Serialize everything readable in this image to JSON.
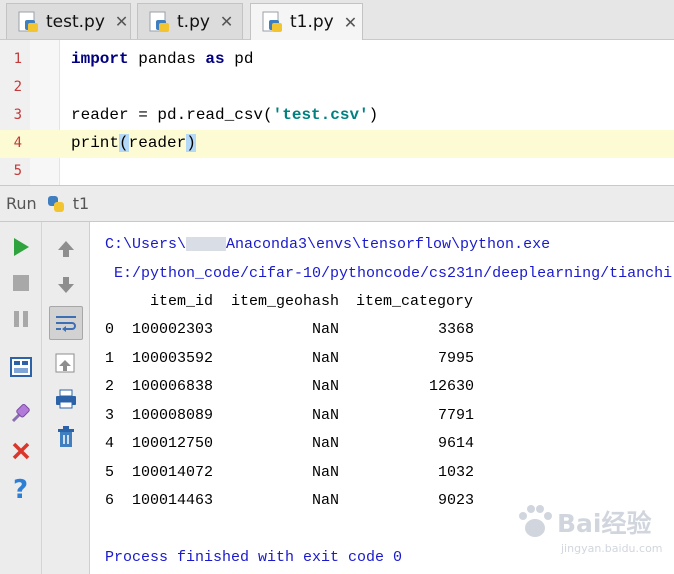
{
  "tabs": [
    {
      "label": "test.py",
      "active": false
    },
    {
      "label": "t.py",
      "active": false
    },
    {
      "label": "t1.py",
      "active": true
    }
  ],
  "tab_close_glyph": "✕",
  "editor": {
    "lines": [
      {
        "num": "1",
        "kw1": "import",
        "t1": " pandas ",
        "kw2": "as",
        "t2": " pd"
      },
      {
        "num": "2"
      },
      {
        "num": "3",
        "pre": "reader = pd.read_csv(",
        "str": "'test.csv'",
        "post": ")"
      },
      {
        "num": "4",
        "fn": "print",
        "open": "(",
        "arg": "reader",
        "close": ")"
      },
      {
        "num": "5"
      }
    ]
  },
  "run_panel": {
    "label": "Run",
    "config": "t1"
  },
  "console": {
    "path_prefix": "C:\\Users\\",
    "path_suffix": "Anaconda3\\envs\\tensorflow\\python.exe",
    "script_path": " E:/python_code/cifar-10/pythoncode/cs231n/deeplearning/tianchi",
    "table": {
      "headers": [
        "item_id",
        "item_geohash",
        "item_category"
      ],
      "rows": [
        [
          "0",
          "100002303",
          "NaN",
          "3368"
        ],
        [
          "1",
          "100003592",
          "NaN",
          "7995"
        ],
        [
          "2",
          "100006838",
          "NaN",
          "12630"
        ],
        [
          "3",
          "100008089",
          "NaN",
          "7791"
        ],
        [
          "4",
          "100012750",
          "NaN",
          "9614"
        ],
        [
          "5",
          "100014072",
          "NaN",
          "1032"
        ],
        [
          "6",
          "100014463",
          "NaN",
          "9023"
        ]
      ]
    },
    "exit_message": "Process finished with exit code 0"
  },
  "watermark": {
    "text": "Bai经验",
    "sub": "jingyan.baidu.com"
  },
  "colors": {
    "keyword": "#000080",
    "string": "#008080",
    "line_number": "#c23a3a",
    "console_blue": "#1a1acc",
    "current_line": "#fdfbd4",
    "run_green": "#2fa33d",
    "stop_red": "#d9362c"
  }
}
